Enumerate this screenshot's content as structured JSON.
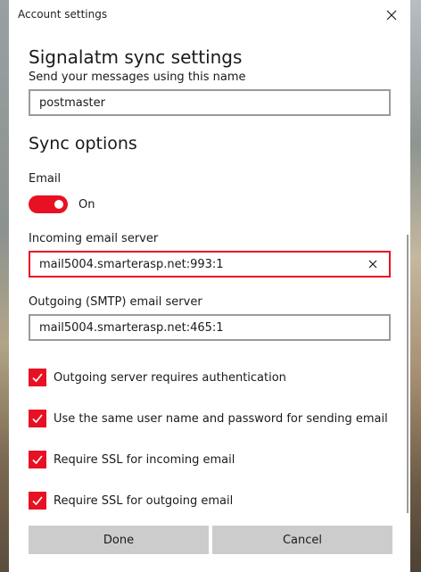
{
  "window": {
    "title": "Account settings"
  },
  "account": {
    "heading": "Signalatm sync settings",
    "name_label": "Send your messages using this name",
    "name_value": "postmaster"
  },
  "sync": {
    "heading": "Sync options",
    "email_label": "Email",
    "email_toggle_state": "On",
    "incoming_label": "Incoming email server",
    "incoming_value": "mail5004.smarterasp.net:993:1",
    "outgoing_label": "Outgoing (SMTP) email server",
    "outgoing_value": "mail5004.smarterasp.net:465:1"
  },
  "options": [
    {
      "label": "Outgoing server requires authentication",
      "checked": true
    },
    {
      "label": "Use the same user name and password for sending email",
      "checked": true
    },
    {
      "label": "Require SSL for incoming email",
      "checked": true
    },
    {
      "label": "Require SSL for outgoing email",
      "checked": true
    }
  ],
  "buttons": {
    "done": "Done",
    "cancel": "Cancel"
  },
  "colors": {
    "accent": "#e81123",
    "button_bg": "#cccccc",
    "border": "#9a9a9a"
  }
}
